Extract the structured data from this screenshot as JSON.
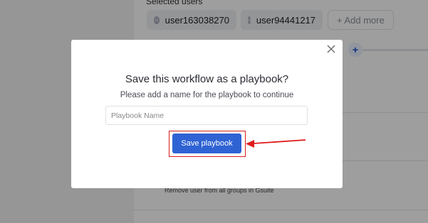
{
  "background": {
    "selected_users_label": "Selected users",
    "users": [
      "user163038270",
      "user94441217"
    ],
    "add_more_label": "+ Add more",
    "add_step_label": "+",
    "row_text": "Remove user from all groups in Gsuite"
  },
  "modal": {
    "title": "Save this workflow as a playbook?",
    "subtitle": "Please add a name for the playbook to continue",
    "input_placeholder": "Playbook Name",
    "input_value": "",
    "save_button_label": "Save playbook",
    "close_icon": "close-icon"
  },
  "annotation": {
    "highlight_color": "#d81e1e"
  },
  "colors": {
    "primary": "#2f63d4",
    "overlay": "rgba(0,0,0,0.38)"
  }
}
